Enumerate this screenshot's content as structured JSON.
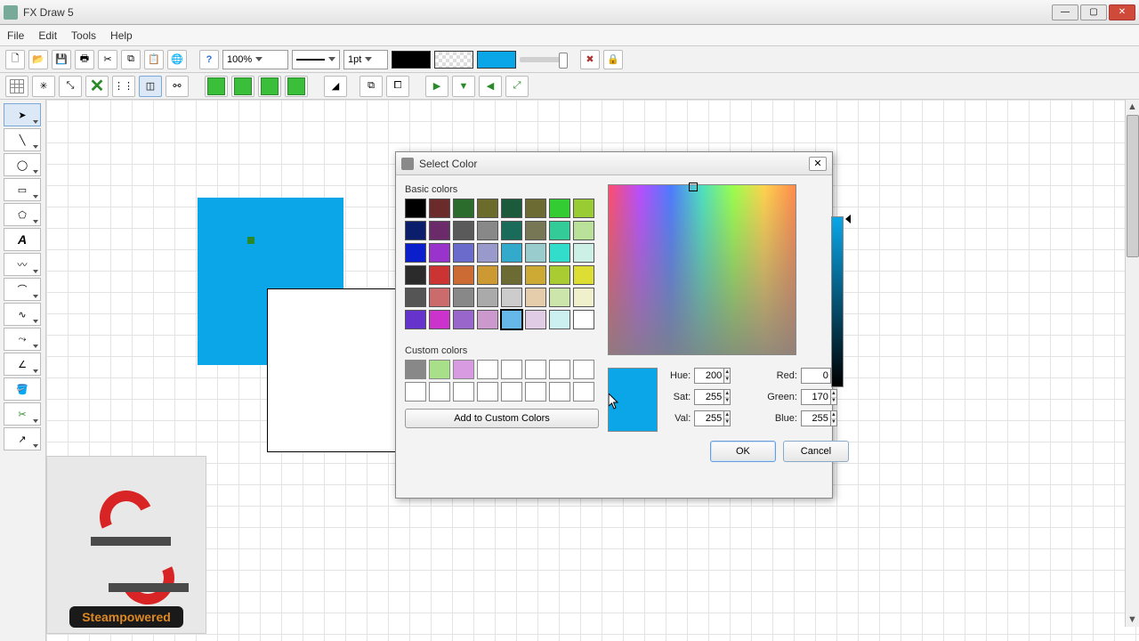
{
  "app": {
    "title": "FX Draw 5"
  },
  "menu": {
    "file": "File",
    "edit": "Edit",
    "tools": "Tools",
    "help": "Help"
  },
  "toolbar": {
    "zoom": "100%",
    "lineweight": "1pt"
  },
  "dialog": {
    "title": "Select Color",
    "basic_label": "Basic colors",
    "custom_label": "Custom colors",
    "add_custom": "Add to Custom Colors",
    "hue_label": "Hue:",
    "sat_label": "Sat:",
    "val_label": "Val:",
    "red_label": "Red:",
    "green_label": "Green:",
    "blue_label": "Blue:",
    "hue": "200",
    "sat": "255",
    "val": "255",
    "red": "0",
    "green": "170",
    "blue": "255",
    "ok": "OK",
    "cancel": "Cancel",
    "preview_color": "#0aa6e8",
    "basic_colors": [
      "#000000",
      "#6b2b2b",
      "#2b6b2b",
      "#6b6b2b",
      "#1b5a3a",
      "#6b6b33",
      "#33cc33",
      "#99cc33",
      "#0b1e6b",
      "#6b2b6b",
      "#5a5a5a",
      "#888888",
      "#1b6b5a",
      "#777755",
      "#33cc99",
      "#b9e199",
      "#0b1ecc",
      "#9933cc",
      "#6b6bcc",
      "#9999cc",
      "#33aacc",
      "#99cccc",
      "#33ddcc",
      "#ccf0e5",
      "#2b2b2b",
      "#cc3333",
      "#cc6b33",
      "#cc9933",
      "#6b6b33",
      "#ccaa33",
      "#aacc33",
      "#dddd33",
      "#555555",
      "#cc6b6b",
      "#888888",
      "#aaaaaa",
      "#cccccc",
      "#e5ccaa",
      "#cce5aa",
      "#f0f0cc",
      "#6633cc",
      "#cc33cc",
      "#9966cc",
      "#cc99cc",
      "#66b8e8",
      "#e0cce5",
      "#ccf0f0",
      "#ffffff"
    ],
    "custom_colors": [
      "#888888",
      "#a8e08a",
      "#d89ae0",
      "",
      "",
      "",
      "",
      "",
      "",
      "",
      "",
      "",
      "",
      "",
      "",
      ""
    ]
  },
  "logo": {
    "label": "Steampowered"
  }
}
